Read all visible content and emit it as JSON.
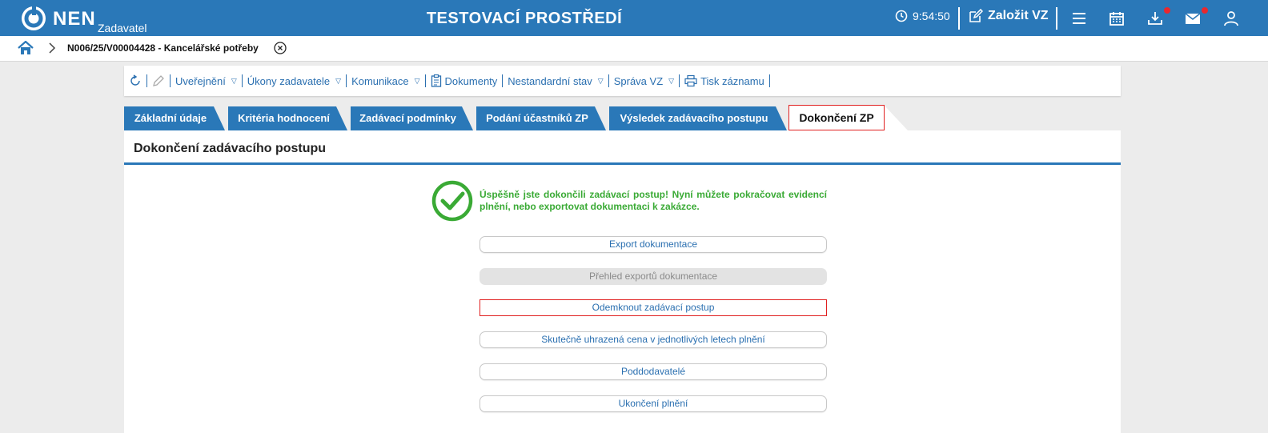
{
  "topbar": {
    "logo_text": "NEN",
    "logo_sub": "Zadavatel",
    "env_title": "TESTOVACÍ PROSTŘEDÍ",
    "time": "9:54:50",
    "create_label": "Založit VZ",
    "icons": [
      "clock-icon",
      "edit-icon",
      "menu-icon",
      "calendar-icon",
      "download-icon",
      "mail-icon",
      "user-icon"
    ],
    "accent": "#2a78b8",
    "notify_color": "#e8282e"
  },
  "breadcrumb": {
    "item": "N006/25/V00004428 - Kancelářské potřeby"
  },
  "toolbar": {
    "items": [
      {
        "label": "Uveřejnění",
        "dropdown": true
      },
      {
        "label": "Úkony zadavatele",
        "dropdown": true
      },
      {
        "label": "Komunikace",
        "dropdown": true
      },
      {
        "label": "Dokumenty",
        "dropdown": false
      },
      {
        "label": "Nestandardní stav",
        "dropdown": true
      },
      {
        "label": "Správa VZ",
        "dropdown": true
      },
      {
        "label": "Tisk záznamu",
        "dropdown": false
      }
    ]
  },
  "tabs": [
    {
      "label": "Základní údaje"
    },
    {
      "label": "Kritéria hodnocení"
    },
    {
      "label": "Zadávací podmínky"
    },
    {
      "label": "Podání účastníků ZP"
    },
    {
      "label": "Výsledek zadávacího postupu"
    },
    {
      "label": "Dokončení ZP",
      "active": true
    }
  ],
  "panel": {
    "title": "Dokončení zadávacího postupu",
    "success_message": "Úspěšně jste dokončili zadávací postup! Nyní můžete pokračovat evidencí plnění, nebo exportovat dokumentaci k zakázce.",
    "success_color": "#3aaa35",
    "buttons": [
      {
        "label": "Export dokumentace",
        "state": "enabled"
      },
      {
        "label": "Přehled exportů dokumentace",
        "state": "disabled"
      },
      {
        "label": "Odemknout zadávací postup",
        "state": "highlighted"
      },
      {
        "label": "Skutečně uhrazená cena v jednotlivých letech plnění",
        "state": "enabled"
      },
      {
        "label": "Poddodavatelé",
        "state": "enabled"
      },
      {
        "label": "Ukončení plnění",
        "state": "enabled"
      }
    ]
  }
}
